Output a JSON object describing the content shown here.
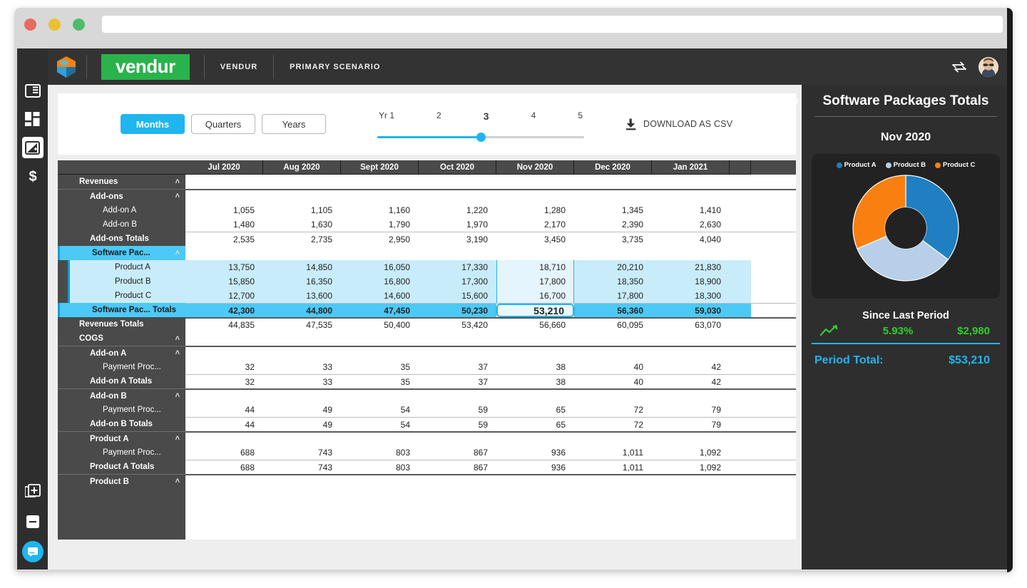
{
  "browser": {
    "url_value": "",
    "url_placeholder": ""
  },
  "topbar": {
    "logo_text": "vendur",
    "workspace": "VENDUR",
    "scenario": "PRIMARY SCENARIO"
  },
  "rail": {
    "items": [
      {
        "icon": "panel-layout-icon",
        "active": false
      },
      {
        "icon": "dashboard-grid-icon",
        "active": false
      },
      {
        "icon": "chart-edit-icon",
        "active": true
      },
      {
        "icon": "dollar-icon",
        "active": false
      }
    ],
    "bottom": [
      {
        "icon": "add-page-icon"
      },
      {
        "icon": "remove-page-icon"
      },
      {
        "icon": "chat-icon"
      }
    ]
  },
  "controls": {
    "segments": [
      {
        "label": "Months",
        "active": true
      },
      {
        "label": "Quarters",
        "active": false
      },
      {
        "label": "Years",
        "active": false
      }
    ],
    "slider": {
      "ticks": [
        "Yr 1",
        "2",
        "3",
        "4",
        "5"
      ],
      "value": 3,
      "value_index": 2
    },
    "download_label": "DOWNLOAD AS CSV"
  },
  "grid": {
    "columns": [
      "Jul 2020",
      "Aug 2020",
      "Sept 2020",
      "Oct 2020",
      "Nov 2020",
      "Dec 2020",
      "Jan 2021"
    ],
    "selected_column": "Nov 2020",
    "selected_column_index": 4,
    "active_cell_value": "53,210",
    "rows": [
      {
        "label": "Revenues",
        "level": "lvl0",
        "chevron": "^",
        "values": [],
        "kind": "group"
      },
      {
        "label": "Add-ons",
        "level": "lvl1",
        "chevron": "^",
        "values": [],
        "kind": "group"
      },
      {
        "label": "Add-on A",
        "level": "lvl2",
        "chevron": "",
        "values": [
          "1,055",
          "1,105",
          "1,160",
          "1,220",
          "1,280",
          "1,345",
          "1,410"
        ],
        "kind": "data"
      },
      {
        "label": "Add-on B",
        "level": "lvl2",
        "chevron": "",
        "values": [
          "1,480",
          "1,630",
          "1,790",
          "1,970",
          "2,170",
          "2,390",
          "2,630"
        ],
        "kind": "data"
      },
      {
        "label": "Add-ons Totals",
        "level": "tot1",
        "chevron": "",
        "values": [
          "2,535",
          "2,735",
          "2,950",
          "3,190",
          "3,450",
          "3,735",
          "4,040"
        ],
        "kind": "total"
      },
      {
        "label": "Software Pac...",
        "level": "lvl1",
        "chevron": "^",
        "values": [],
        "kind": "group-selected"
      },
      {
        "label": "Product A",
        "level": "lvl2",
        "chevron": "",
        "values": [
          "13,750",
          "14,850",
          "16,050",
          "17,330",
          "18,710",
          "20,210",
          "21,830"
        ],
        "kind": "data-selected"
      },
      {
        "label": "Product B",
        "level": "lvl2",
        "chevron": "",
        "values": [
          "15,850",
          "16,350",
          "16,800",
          "17,300",
          "17,800",
          "18,350",
          "18,900"
        ],
        "kind": "data-selected"
      },
      {
        "label": "Product C",
        "level": "lvl2",
        "chevron": "",
        "values": [
          "12,700",
          "13,600",
          "14,600",
          "15,600",
          "16,700",
          "17,800",
          "18,300"
        ],
        "kind": "data-selected"
      },
      {
        "label": "Software Pac... Totals",
        "level": "tot1",
        "chevron": "",
        "values": [
          "42,300",
          "44,800",
          "47,450",
          "50,230",
          "53,210",
          "56,360",
          "59,030"
        ],
        "kind": "total-selected"
      },
      {
        "label": "Revenues Totals",
        "level": "tot0",
        "chevron": "",
        "values": [
          "44,835",
          "47,535",
          "50,400",
          "53,420",
          "56,660",
          "60,095",
          "63,070"
        ],
        "kind": "total"
      },
      {
        "label": "COGS",
        "level": "lvl0",
        "chevron": "^",
        "values": [],
        "kind": "group"
      },
      {
        "label": "Add-on A",
        "level": "lvl1",
        "chevron": "^",
        "values": [],
        "kind": "group"
      },
      {
        "label": "Payment Proc...",
        "level": "lvl2",
        "chevron": "",
        "values": [
          "32",
          "33",
          "35",
          "37",
          "38",
          "40",
          "42"
        ],
        "kind": "data"
      },
      {
        "label": "Add-on A Totals",
        "level": "tot1",
        "chevron": "",
        "values": [
          "32",
          "33",
          "35",
          "37",
          "38",
          "40",
          "42"
        ],
        "kind": "total"
      },
      {
        "label": "Add-on B",
        "level": "lvl1",
        "chevron": "^",
        "values": [],
        "kind": "group"
      },
      {
        "label": "Payment Proc...",
        "level": "lvl2",
        "chevron": "",
        "values": [
          "44",
          "49",
          "54",
          "59",
          "65",
          "72",
          "79"
        ],
        "kind": "data"
      },
      {
        "label": "Add-on B Totals",
        "level": "tot1",
        "chevron": "",
        "values": [
          "44",
          "49",
          "54",
          "59",
          "65",
          "72",
          "79"
        ],
        "kind": "total"
      },
      {
        "label": "Product A",
        "level": "lvl1",
        "chevron": "^",
        "values": [],
        "kind": "group"
      },
      {
        "label": "Payment Proc...",
        "level": "lvl2",
        "chevron": "",
        "values": [
          "688",
          "743",
          "803",
          "867",
          "936",
          "1,011",
          "1,092"
        ],
        "kind": "data"
      },
      {
        "label": "Product A Totals",
        "level": "tot1",
        "chevron": "",
        "values": [
          "688",
          "743",
          "803",
          "867",
          "936",
          "1,011",
          "1,092"
        ],
        "kind": "total"
      },
      {
        "label": "Product B",
        "level": "lvl1",
        "chevron": "^",
        "values": [],
        "kind": "group"
      }
    ]
  },
  "panel": {
    "title": "Software Packages Totals",
    "period": "Nov 2020",
    "since_last_period_label": "Since Last Period",
    "change_percent": "5.93%",
    "change_amount": "$2,980",
    "period_total_label": "Period Total:",
    "period_total_value": "$53,210",
    "trend": "up"
  },
  "colors": {
    "accent_blue": "#1fb6ef",
    "brand_green": "#2ab34c",
    "positive_green": "#33cc33",
    "product_a": "#1f7fc0",
    "product_b": "#b7cfe8",
    "product_c": "#f98010",
    "dark_chrome": "#333333",
    "rail_dark": "#2e2e2e"
  },
  "chart_data": {
    "type": "pie",
    "title": "Software Packages Totals",
    "subtitle": "Nov 2020",
    "legend_position": "top",
    "categories": [
      "Product A",
      "Product B",
      "Product C"
    ],
    "values": [
      18710,
      17800,
      16700
    ],
    "percentages": [
      35.2,
      33.5,
      31.4
    ],
    "colors": [
      "#1f7fc0",
      "#b7cfe8",
      "#f98010"
    ],
    "total": 53210,
    "donut": true
  }
}
